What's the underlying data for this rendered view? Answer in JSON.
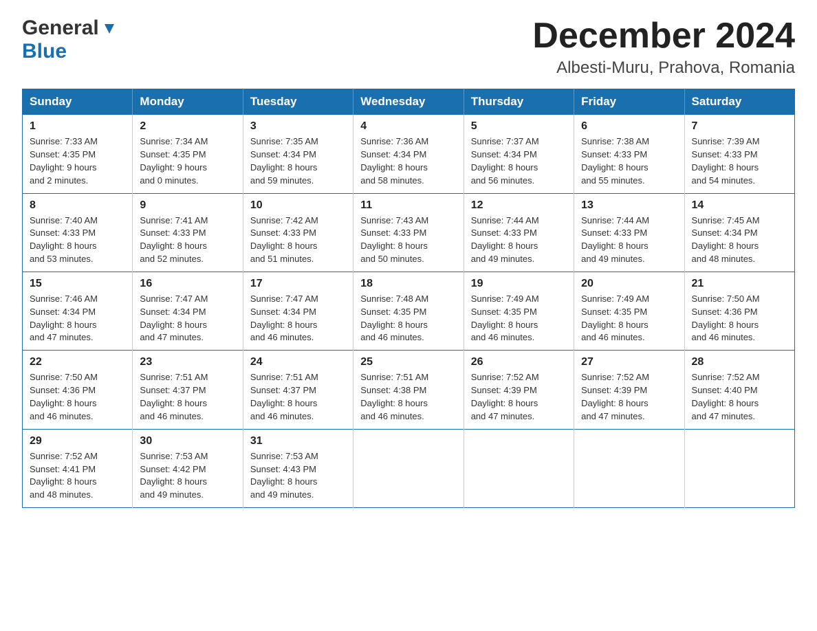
{
  "header": {
    "logo_general": "General",
    "logo_blue": "Blue",
    "month_title": "December 2024",
    "location": "Albesti-Muru, Prahova, Romania"
  },
  "days_of_week": [
    "Sunday",
    "Monday",
    "Tuesday",
    "Wednesday",
    "Thursday",
    "Friday",
    "Saturday"
  ],
  "weeks": [
    [
      {
        "day": "1",
        "sunrise": "7:33 AM",
        "sunset": "4:35 PM",
        "daylight": "9 hours and 2 minutes."
      },
      {
        "day": "2",
        "sunrise": "7:34 AM",
        "sunset": "4:35 PM",
        "daylight": "9 hours and 0 minutes."
      },
      {
        "day": "3",
        "sunrise": "7:35 AM",
        "sunset": "4:34 PM",
        "daylight": "8 hours and 59 minutes."
      },
      {
        "day": "4",
        "sunrise": "7:36 AM",
        "sunset": "4:34 PM",
        "daylight": "8 hours and 58 minutes."
      },
      {
        "day": "5",
        "sunrise": "7:37 AM",
        "sunset": "4:34 PM",
        "daylight": "8 hours and 56 minutes."
      },
      {
        "day": "6",
        "sunrise": "7:38 AM",
        "sunset": "4:33 PM",
        "daylight": "8 hours and 55 minutes."
      },
      {
        "day": "7",
        "sunrise": "7:39 AM",
        "sunset": "4:33 PM",
        "daylight": "8 hours and 54 minutes."
      }
    ],
    [
      {
        "day": "8",
        "sunrise": "7:40 AM",
        "sunset": "4:33 PM",
        "daylight": "8 hours and 53 minutes."
      },
      {
        "day": "9",
        "sunrise": "7:41 AM",
        "sunset": "4:33 PM",
        "daylight": "8 hours and 52 minutes."
      },
      {
        "day": "10",
        "sunrise": "7:42 AM",
        "sunset": "4:33 PM",
        "daylight": "8 hours and 51 minutes."
      },
      {
        "day": "11",
        "sunrise": "7:43 AM",
        "sunset": "4:33 PM",
        "daylight": "8 hours and 50 minutes."
      },
      {
        "day": "12",
        "sunrise": "7:44 AM",
        "sunset": "4:33 PM",
        "daylight": "8 hours and 49 minutes."
      },
      {
        "day": "13",
        "sunrise": "7:44 AM",
        "sunset": "4:33 PM",
        "daylight": "8 hours and 49 minutes."
      },
      {
        "day": "14",
        "sunrise": "7:45 AM",
        "sunset": "4:34 PM",
        "daylight": "8 hours and 48 minutes."
      }
    ],
    [
      {
        "day": "15",
        "sunrise": "7:46 AM",
        "sunset": "4:34 PM",
        "daylight": "8 hours and 47 minutes."
      },
      {
        "day": "16",
        "sunrise": "7:47 AM",
        "sunset": "4:34 PM",
        "daylight": "8 hours and 47 minutes."
      },
      {
        "day": "17",
        "sunrise": "7:47 AM",
        "sunset": "4:34 PM",
        "daylight": "8 hours and 46 minutes."
      },
      {
        "day": "18",
        "sunrise": "7:48 AM",
        "sunset": "4:35 PM",
        "daylight": "8 hours and 46 minutes."
      },
      {
        "day": "19",
        "sunrise": "7:49 AM",
        "sunset": "4:35 PM",
        "daylight": "8 hours and 46 minutes."
      },
      {
        "day": "20",
        "sunrise": "7:49 AM",
        "sunset": "4:35 PM",
        "daylight": "8 hours and 46 minutes."
      },
      {
        "day": "21",
        "sunrise": "7:50 AM",
        "sunset": "4:36 PM",
        "daylight": "8 hours and 46 minutes."
      }
    ],
    [
      {
        "day": "22",
        "sunrise": "7:50 AM",
        "sunset": "4:36 PM",
        "daylight": "8 hours and 46 minutes."
      },
      {
        "day": "23",
        "sunrise": "7:51 AM",
        "sunset": "4:37 PM",
        "daylight": "8 hours and 46 minutes."
      },
      {
        "day": "24",
        "sunrise": "7:51 AM",
        "sunset": "4:37 PM",
        "daylight": "8 hours and 46 minutes."
      },
      {
        "day": "25",
        "sunrise": "7:51 AM",
        "sunset": "4:38 PM",
        "daylight": "8 hours and 46 minutes."
      },
      {
        "day": "26",
        "sunrise": "7:52 AM",
        "sunset": "4:39 PM",
        "daylight": "8 hours and 47 minutes."
      },
      {
        "day": "27",
        "sunrise": "7:52 AM",
        "sunset": "4:39 PM",
        "daylight": "8 hours and 47 minutes."
      },
      {
        "day": "28",
        "sunrise": "7:52 AM",
        "sunset": "4:40 PM",
        "daylight": "8 hours and 47 minutes."
      }
    ],
    [
      {
        "day": "29",
        "sunrise": "7:52 AM",
        "sunset": "4:41 PM",
        "daylight": "8 hours and 48 minutes."
      },
      {
        "day": "30",
        "sunrise": "7:53 AM",
        "sunset": "4:42 PM",
        "daylight": "8 hours and 49 minutes."
      },
      {
        "day": "31",
        "sunrise": "7:53 AM",
        "sunset": "4:43 PM",
        "daylight": "8 hours and 49 minutes."
      },
      null,
      null,
      null,
      null
    ]
  ],
  "labels": {
    "sunrise": "Sunrise:",
    "sunset": "Sunset:",
    "daylight": "Daylight:"
  }
}
